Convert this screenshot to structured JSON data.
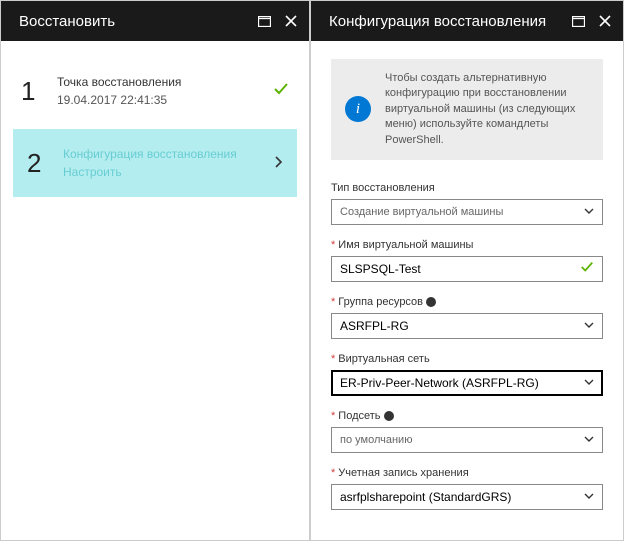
{
  "left": {
    "title": "Восстановить",
    "step1": {
      "title": "Точка восстановления",
      "subtitle": "19.04.2017 22:41:35"
    },
    "step2": {
      "title": "Конфигурация восстановления",
      "subtitle": "Настроить"
    }
  },
  "right": {
    "title": "Конфигурация восстановления",
    "info_text": "Чтобы создать альтернативную конфигурацию при восстановлении виртуальной машины (из следующих меню) используйте командлеты PowerShell.",
    "fields": {
      "restore_type": {
        "label": "Тип восстановления",
        "value": "Создание виртуальной машины"
      },
      "vm_name": {
        "label": "Имя виртуальной машины",
        "value": "SLSPSQL-Test"
      },
      "resource_group": {
        "label": "Группа ресурсов",
        "value": "ASRFPL-RG"
      },
      "vnet": {
        "label": "Виртуальная сеть",
        "value": "ER-Priv-Peer-Network (ASRFPL-RG)"
      },
      "subnet": {
        "label": "Подсеть",
        "value": "по умолчанию"
      },
      "storage": {
        "label": "Учетная запись хранения",
        "value": "asrfplsharepoint (StandardGRS)"
      }
    }
  },
  "icons": {
    "info_glyph": "i"
  }
}
